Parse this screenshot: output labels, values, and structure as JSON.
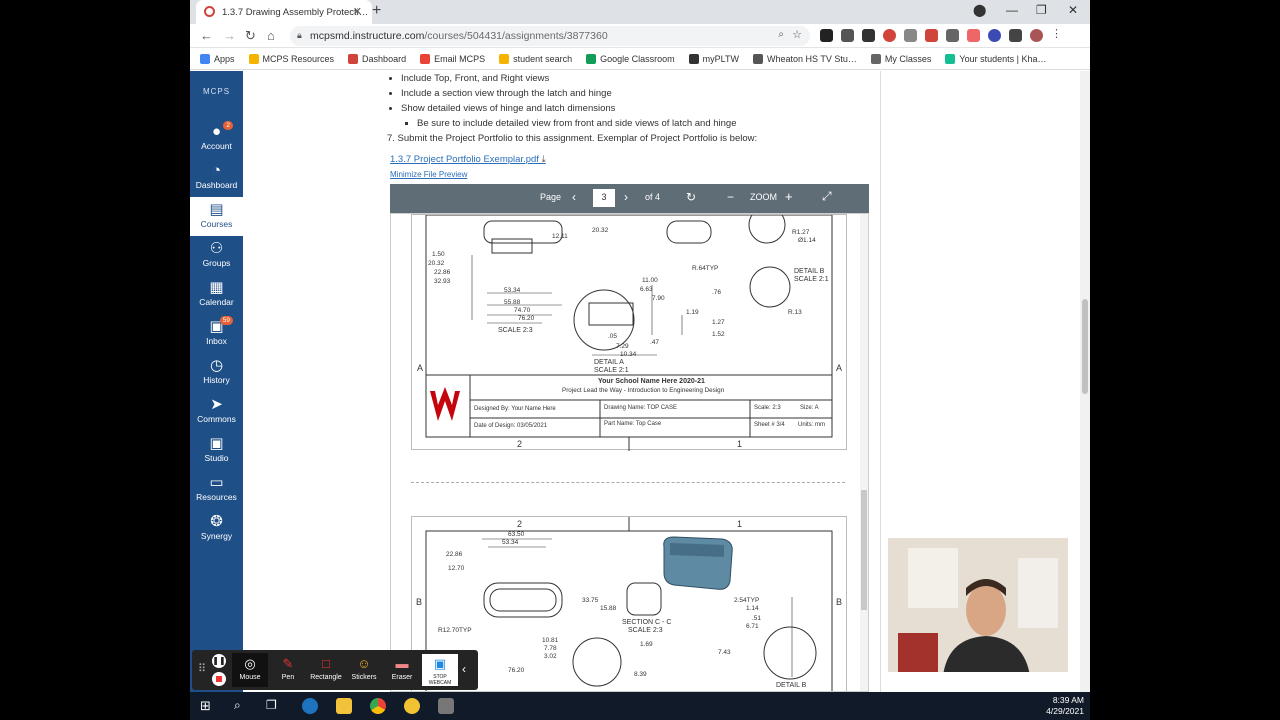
{
  "browser": {
    "tab_title": "1.3.7 Drawing Assembly Protecti…",
    "url_main": "mcpsmd.instructure.com",
    "url_path": "/courses/504431/assignments/3877360",
    "bookmarks": [
      "Apps",
      "MCPS Resources",
      "Dashboard",
      "Email MCPS",
      "student search",
      "Google Classroom",
      "myPLTW",
      "Wheaton HS TV Stu…",
      "My Classes",
      "Your students | Kha…"
    ],
    "bookmark_colors": [
      "#4285f4",
      "#f4b400",
      "#d0443b",
      "#ea4335",
      "#f4b400",
      "#0f9d58",
      "#333333",
      "#555555",
      "#666666",
      "#14bf96"
    ]
  },
  "sidebar": {
    "logo": "MCPS",
    "items": [
      {
        "label": "Account",
        "icon": "account-icon",
        "glyph": "●",
        "badge": "2"
      },
      {
        "label": "Dashboard",
        "icon": "dashboard-icon",
        "glyph": "◔",
        "badge": ""
      },
      {
        "label": "Courses",
        "icon": "courses-icon",
        "glyph": "▤",
        "badge": ""
      },
      {
        "label": "Groups",
        "icon": "groups-icon",
        "glyph": "⚇",
        "badge": ""
      },
      {
        "label": "Calendar",
        "icon": "calendar-icon",
        "glyph": "▦",
        "badge": ""
      },
      {
        "label": "Inbox",
        "icon": "inbox-icon",
        "glyph": "▣",
        "badge": "59"
      },
      {
        "label": "History",
        "icon": "history-icon",
        "glyph": "◷",
        "badge": ""
      },
      {
        "label": "Commons",
        "icon": "commons-icon",
        "glyph": "➤",
        "badge": ""
      },
      {
        "label": "Studio",
        "icon": "studio-icon",
        "glyph": "▣",
        "badge": ""
      },
      {
        "label": "Resources",
        "icon": "resources-icon",
        "glyph": "▭",
        "badge": ""
      },
      {
        "label": "Synergy",
        "icon": "synergy-icon",
        "glyph": "❂",
        "badge": ""
      }
    ]
  },
  "instructions": {
    "bullets": [
      "Include Top, Front, and Right views",
      "Include a section view through the latch and hinge",
      "Show detailed views of hinge and latch dimensions"
    ],
    "sub_bullet": "Be sure to include detailed view from front and side views of latch and hinge",
    "step7": "7. Submit the Project Portfolio to this assignment.  Exemplar of Project Portfolio is below:",
    "file_link": "1.3.7 Project Portfolio Exemplar.pdf",
    "minimize": "Minimize File Preview"
  },
  "pdf": {
    "page_label": "Page",
    "page_value": "3",
    "page_total": "of 4",
    "zoom_label": "ZOOM",
    "title_block": {
      "school": "Your School Name Here 2020-21",
      "course": "Project Lead the Way - Introduction to Engineering Design",
      "designed_by": "Designed By:   Your Name Here",
      "drawing_name": "Drawing Name: TOP CASE",
      "scale": "Scale: 2:3",
      "size": "Size: A",
      "date": "Date of Design: 03/05/2021",
      "part_name": "Part Name:  Top Case",
      "sheet": "Sheet # 3/4",
      "units": "Units: mm"
    },
    "page3_labels": {
      "scale_23": "SCALE 2:3",
      "detail_a": "DETAIL A",
      "detail_a_scale": "SCALE 2:1",
      "detail_b": "DETAIL B",
      "detail_b_scale": "SCALE 2:1",
      "row_a": "A",
      "col_2": "2",
      "col_1": "1",
      "dims": [
        "1.50",
        "20.32",
        "22.86",
        "32.93",
        "53.34",
        "55.88",
        "74.70",
        "76.20",
        "12.11",
        "20.32",
        "11.00",
        "6.63",
        "7.90",
        "1.19",
        "R.64TYP",
        ".76",
        "1.27",
        "1.52",
        "R1.27",
        "Ø1.14",
        "R.13",
        ".05",
        "7.29",
        "10.34",
        ".47"
      ]
    },
    "page4_labels": {
      "col_2": "2",
      "col_1": "1",
      "row_b": "B",
      "section": "SECTION C - C",
      "section_scale": "SCALE 2:3",
      "detail_b": "DETAIL B",
      "dims": [
        "63.50",
        "53.34",
        "22.86",
        "12.70",
        "R12.70TYP",
        "33.75",
        "15.88",
        "10.81",
        "7.78",
        "3.02",
        "76.20",
        "1.69",
        "8.39",
        "2.54TYP",
        "1.14",
        ".51",
        "6.71",
        "7.43"
      ]
    }
  },
  "recorder": {
    "tools": [
      {
        "label": "Mouse",
        "icon": "mouse-icon",
        "glyph": "◎"
      },
      {
        "label": "Pen",
        "icon": "pen-icon",
        "glyph": "✎"
      },
      {
        "label": "Rectangle",
        "icon": "rectangle-icon",
        "glyph": "□"
      },
      {
        "label": "Stickers",
        "icon": "stickers-icon",
        "glyph": "☺"
      },
      {
        "label": "Eraser",
        "icon": "eraser-icon",
        "glyph": "▬"
      },
      {
        "label": "STOP WEBCAM",
        "icon": "webcam-icon",
        "glyph": "▣"
      }
    ]
  },
  "taskbar": {
    "time": "8:39 AM",
    "date": "4/29/2021"
  }
}
